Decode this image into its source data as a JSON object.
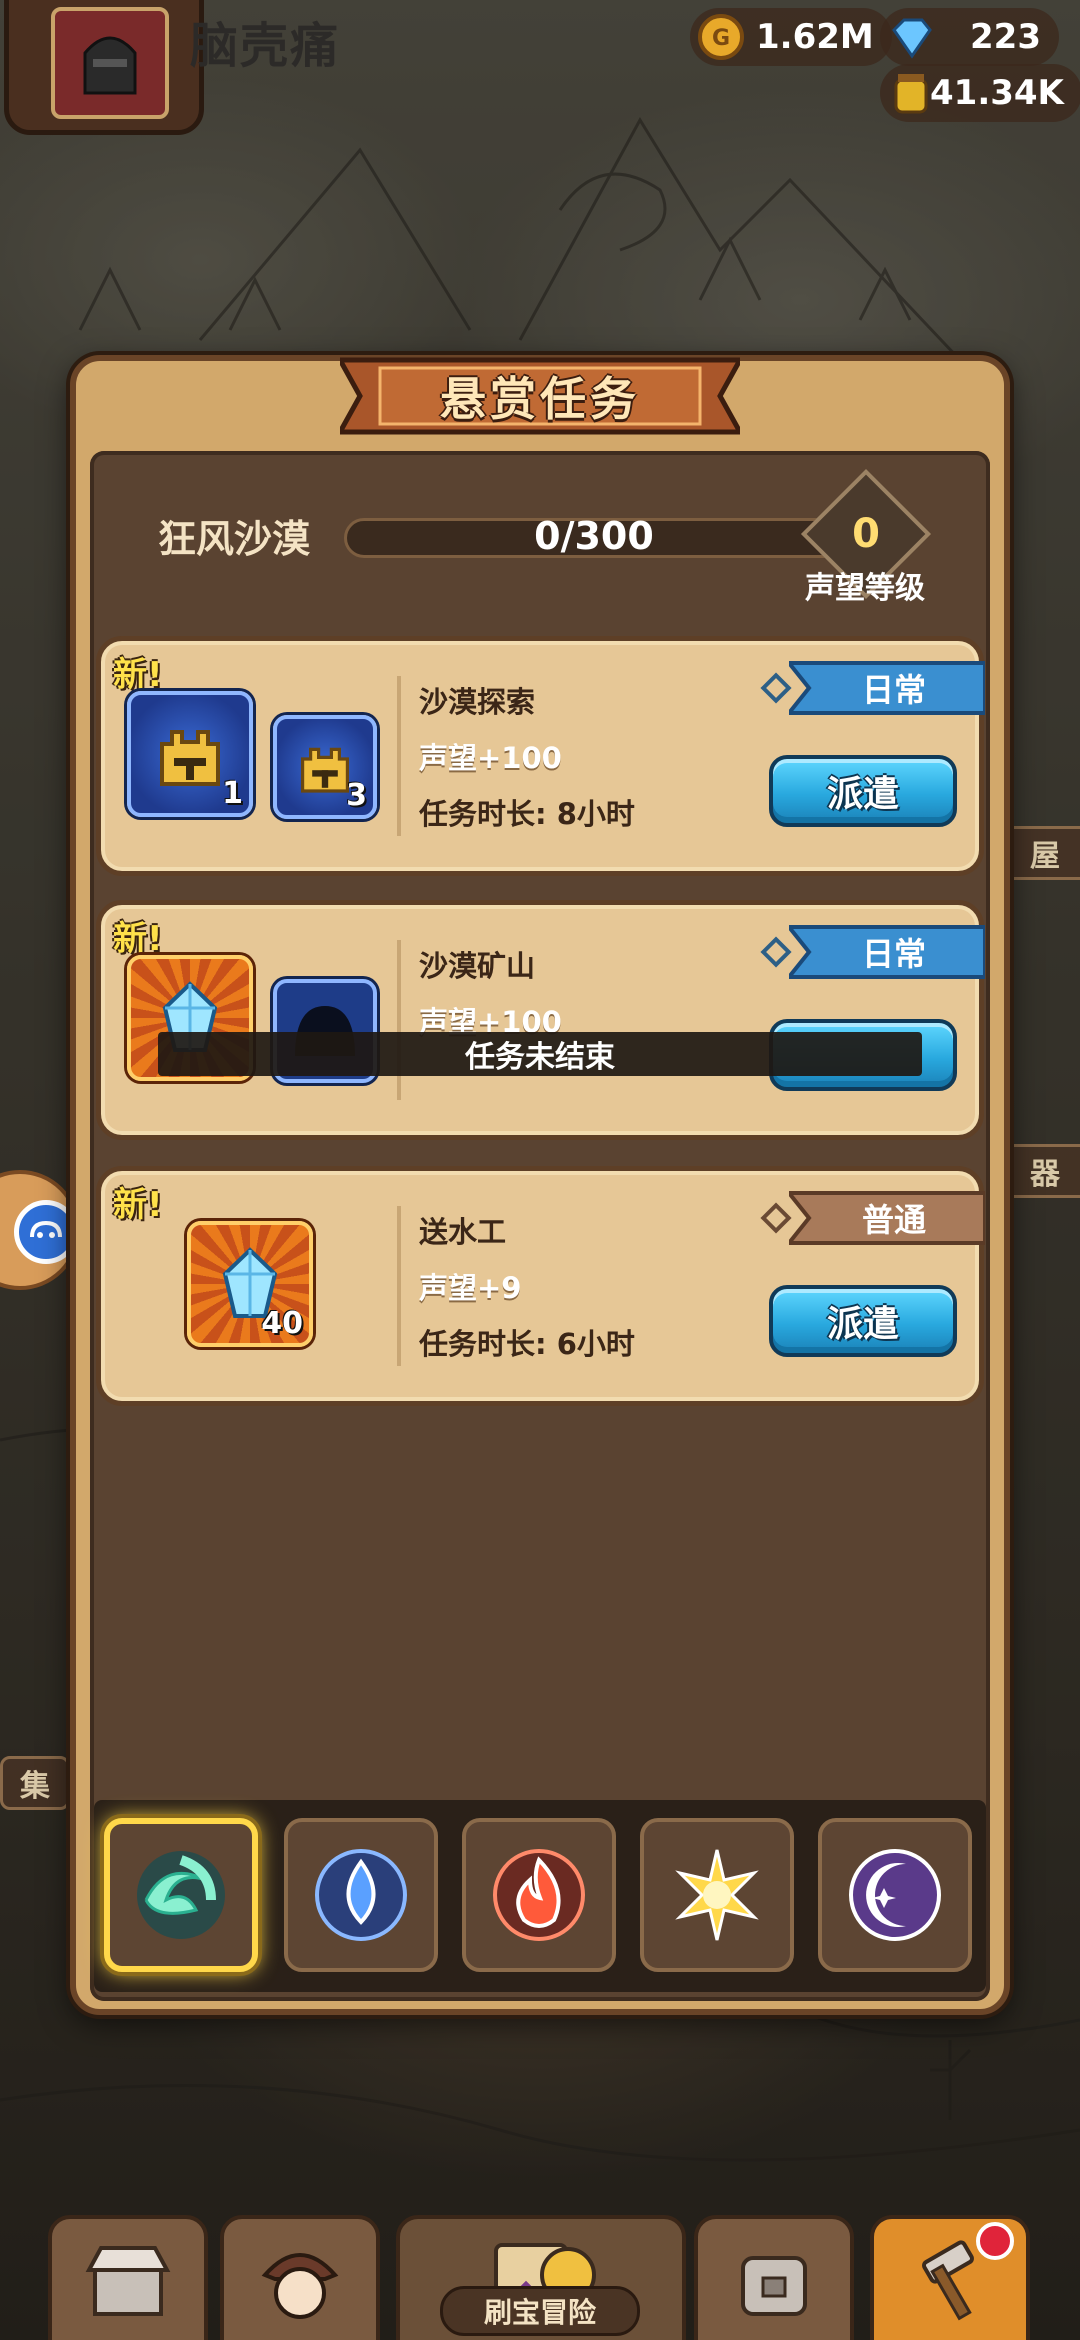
{
  "header": {
    "player_name": "脑壳痛",
    "gold": "1.62M",
    "gems": "223",
    "resource3": "41.34K"
  },
  "dialog": {
    "title": "悬赏任务",
    "region": {
      "name": "狂风沙漠",
      "progress_text": "0/300",
      "progress_fraction": 0,
      "reputation_level": "0",
      "reputation_label": "声望等级"
    },
    "tasks": [
      {
        "new_label": "新!",
        "name": "沙漠探索",
        "reputation": "声望+100",
        "duration": "任务时长: 8小时",
        "type": "日常",
        "button": "派遣",
        "rewards": [
          {
            "icon": "golden-helmet-icon",
            "count": "1"
          },
          {
            "icon": "golden-helmet-icon",
            "count": "3"
          }
        ]
      },
      {
        "new_label": "新!",
        "name": "沙漠矿山",
        "reputation": "声望+100",
        "type": "日常",
        "rewards": [
          {
            "icon": "blue-crystal-icon"
          },
          {
            "icon": "silhouette-icon"
          }
        ]
      },
      {
        "new_label": "新!",
        "name": "送水工",
        "reputation": "声望+9",
        "duration": "任务时长: 6小时",
        "type": "普通",
        "button": "派遣",
        "rewards": [
          {
            "icon": "blue-crystal-icon",
            "count": "40"
          }
        ]
      }
    ],
    "toast": "任务未结束",
    "element_tabs": [
      {
        "icon": "wind-icon",
        "active": true
      },
      {
        "icon": "water-icon",
        "active": false
      },
      {
        "icon": "fire-icon",
        "active": false
      },
      {
        "icon": "light-icon",
        "active": false
      },
      {
        "icon": "dark-moon-icon",
        "active": false
      }
    ]
  },
  "side": {
    "edge_tab_1": "屋",
    "edge_tab_2": "器",
    "edge_tab_3": "集"
  },
  "bottom_nav": {
    "center_label": "刷宝冒险"
  },
  "colors": {
    "dispatch_button": "#29a9df",
    "daily_banner": "#3a8fd0",
    "normal_banner": "#a87a5a",
    "new_tag": "#ffe14a"
  }
}
